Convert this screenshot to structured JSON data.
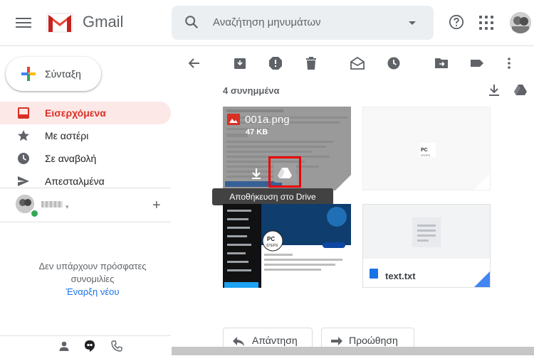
{
  "header": {
    "app_name": "Gmail",
    "search_placeholder": "Αναζήτηση μηνυμάτων"
  },
  "sidebar": {
    "compose_label": "Σύνταξη",
    "items": [
      {
        "label": "Εισερχόμενα",
        "icon": "inbox-icon",
        "active": true
      },
      {
        "label": "Με αστέρι",
        "icon": "star-icon",
        "active": false
      },
      {
        "label": "Σε αναβολή",
        "icon": "clock-icon",
        "active": false
      },
      {
        "label": "Απεσταλμένα",
        "icon": "send-icon",
        "active": false
      }
    ],
    "chat": {
      "no_conversations": "Δεν υπάρχουν πρόσφατες συνομιλίες",
      "start_new": "Έναρξη νέου"
    }
  },
  "toolbar": {
    "icons": [
      "back-arrow-icon",
      "archive-icon",
      "report-spam-icon",
      "delete-icon",
      "mark-unread-icon",
      "snooze-icon",
      "move-to-icon",
      "label-icon",
      "more-vert-icon"
    ]
  },
  "attachments": {
    "count_label": "4 συνημμένα",
    "files": [
      {
        "name": "001a.png",
        "size": "47 KB",
        "hovered": true
      },
      {
        "name": "",
        "size": ""
      },
      {
        "name": "",
        "size": ""
      },
      {
        "name": "text.txt",
        "size": ""
      }
    ],
    "tooltip": "Αποθήκευση στο Drive",
    "brand_mark": "PC STEPS"
  },
  "reply": {
    "reply_label": "Απάντηση",
    "forward_label": "Προώθηση"
  },
  "colors": {
    "accent_red": "#d93025",
    "active_bg": "#fce8e6",
    "link_blue": "#1a73e8",
    "online_green": "#34a853"
  }
}
